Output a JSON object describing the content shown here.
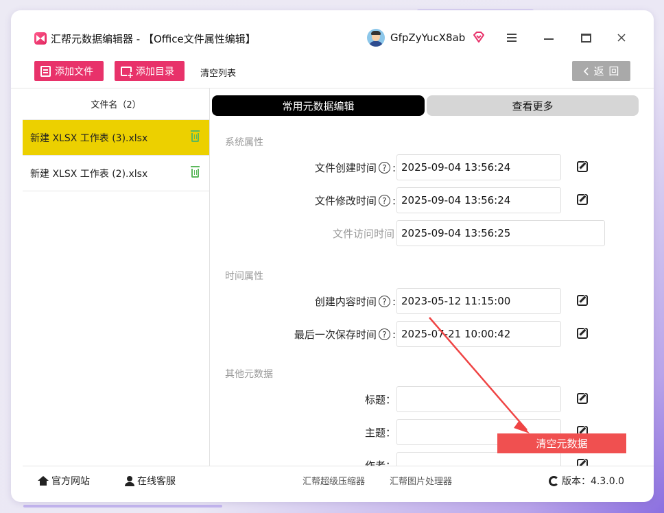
{
  "app": {
    "title": "汇帮元数据编辑器 - 【Office文件属性编辑】",
    "user_name": "GfpZyYucX8ab",
    "brand_color": "#e8326a"
  },
  "toolbar": {
    "add_file": "添加文件",
    "add_dir": "添加目录",
    "clear_list": "清空列表",
    "back": "返 回"
  },
  "file_list": {
    "header": "文件名（2）",
    "items": [
      {
        "name": "新建 XLSX 工作表 (3).xlsx",
        "selected": true
      },
      {
        "name": "新建 XLSX 工作表 (2).xlsx",
        "selected": false
      }
    ]
  },
  "tabs": {
    "active": "常用元数据编辑",
    "more": "查看更多"
  },
  "sections": {
    "system": "系统属性",
    "time": "时间属性",
    "other": "其他元数据"
  },
  "fields": {
    "created": {
      "label": "文件创建时间",
      "value": "2025-09-04 13:56:24"
    },
    "modified": {
      "label": "文件修改时间",
      "value": "2025-09-04 13:56:24"
    },
    "accessed": {
      "label": "文件访问时间",
      "value": "2025-09-04 13:56:25"
    },
    "content_created": {
      "label": "创建内容时间",
      "value": "2023-05-12 11:15:00"
    },
    "last_saved": {
      "label": "最后一次保存时间",
      "value": "2025-07-21 10:00:42"
    },
    "title": {
      "label": "标题：",
      "value": ""
    },
    "subject": {
      "label": "主题：",
      "value": ""
    },
    "author": {
      "label": "作者：",
      "value": ""
    }
  },
  "actions": {
    "clear_metadata": "清空元数据"
  },
  "footer": {
    "website": "官方网站",
    "support": "在线客服",
    "compressor": "汇帮超级压缩器",
    "image_tool": "汇帮图片处理器",
    "version": "版本：4.3.0.0"
  },
  "icons": {
    "app_logo": "app-logo-icon",
    "vip": "diamond-icon",
    "edit": "edit-icon",
    "delete": "trash-icon",
    "help": "question-icon"
  }
}
